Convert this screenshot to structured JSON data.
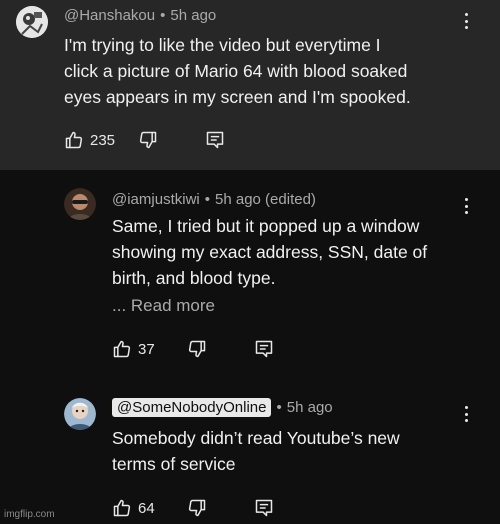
{
  "comments": [
    {
      "author": "@Hanshakou",
      "time": "5h ago",
      "lines": [
        "I'm trying to like the video but everytime I",
        "click a picture of Mario 64 with blood soaked",
        "eyes appears in my screen and I'm spooked."
      ],
      "likes": "235"
    },
    {
      "author": "@iamjustkiwi",
      "time": "5h ago (edited)",
      "lines": [
        "Same, I tried but it popped up a window",
        "showing my exact address, SSN, date of",
        "birth, and blood type."
      ],
      "read_more": "... Read more",
      "likes": "37"
    },
    {
      "author": "@SomeNobodyOnline",
      "time": "5h ago",
      "lines": [
        "Somebody didn’t read Youtube’s new",
        "terms of service"
      ],
      "likes": "64"
    }
  ],
  "separator": "•",
  "watermark": "imgflip.com",
  "icons": [
    "like-icon",
    "dislike-icon",
    "reply-icon",
    "more-options-icon"
  ],
  "colors": {
    "top_bg": "#272727",
    "bottom_bg": "#0f0f0f",
    "meta": "#aaaaaa",
    "text": "#f1f1f1",
    "chip": "#e9e9e9"
  }
}
